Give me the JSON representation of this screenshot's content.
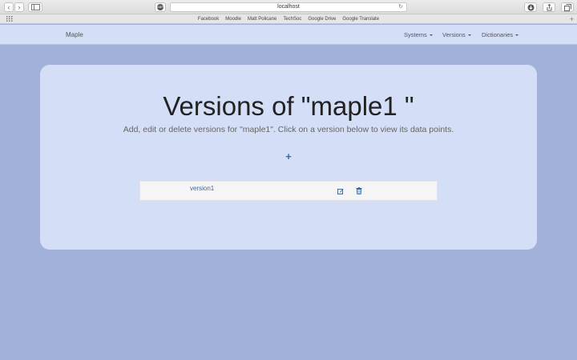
{
  "browser": {
    "url": "localhost",
    "bookmarks": [
      "Facebook",
      "Moodle",
      "Matt Policane",
      "TechSoc",
      "Google Drive",
      "Google Translate"
    ]
  },
  "navbar": {
    "brand": "Maple",
    "menus": [
      {
        "label": "Systems"
      },
      {
        "label": "Versions"
      },
      {
        "label": "Dictionaries"
      }
    ]
  },
  "main": {
    "title": "Versions of \"maple1 \"",
    "subtitle": "Add, edit or delete versions for \"maple1\". Click on a version below to view its data points.",
    "add_icon": "plus-icon",
    "versions": [
      {
        "name": "version1",
        "edit_icon": "edit-icon",
        "delete_icon": "trash-icon"
      }
    ]
  },
  "colors": {
    "page_background": "#a2b1d9",
    "panel_background": "#d4def6",
    "accent": "#3a6aa6",
    "row_background": "#f5f5f5"
  }
}
